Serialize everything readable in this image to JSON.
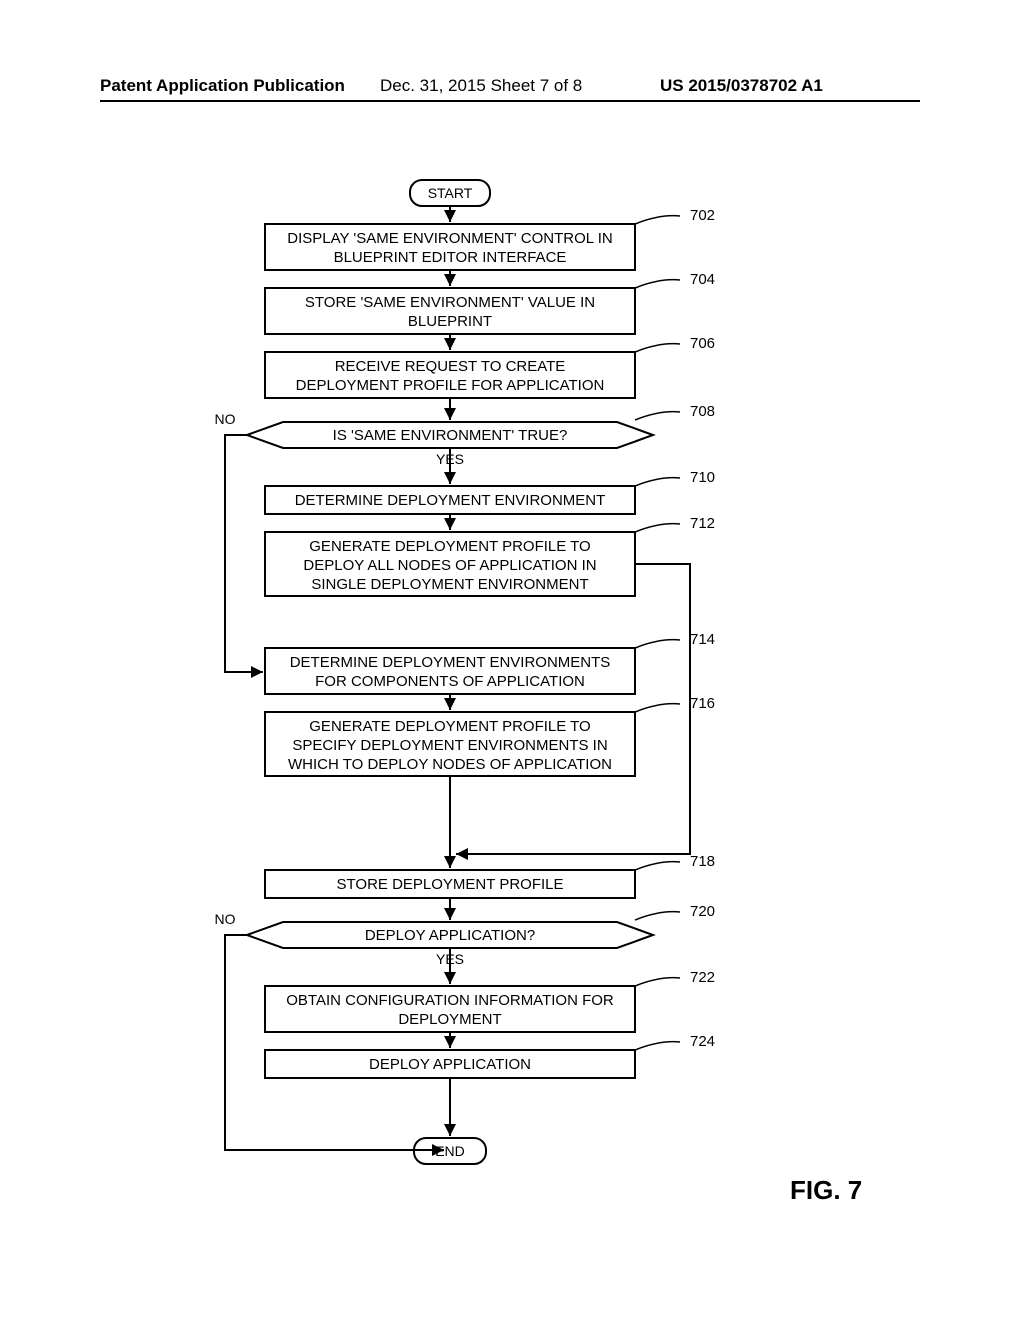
{
  "header": {
    "left": "Patent Application Publication",
    "center": "Dec. 31, 2015   Sheet 7 of 8",
    "right": "US 2015/0378702 A1"
  },
  "figure_caption": "FIG. 7",
  "terminals": {
    "start": "START",
    "end": "END"
  },
  "labels": {
    "no": "NO",
    "yes": "YES"
  },
  "steps": {
    "702": {
      "ref": "702",
      "lines": [
        "DISPLAY 'SAME ENVIRONMENT' CONTROL IN",
        "BLUEPRINT EDITOR INTERFACE"
      ]
    },
    "704": {
      "ref": "704",
      "lines": [
        "STORE 'SAME ENVIRONMENT' VALUE IN",
        "BLUEPRINT"
      ]
    },
    "706": {
      "ref": "706",
      "lines": [
        "RECEIVE REQUEST TO CREATE",
        "DEPLOYMENT PROFILE FOR APPLICATION"
      ]
    },
    "708": {
      "ref": "708",
      "lines": [
        "IS 'SAME ENVIRONMENT' TRUE?"
      ]
    },
    "710": {
      "ref": "710",
      "lines": [
        "DETERMINE DEPLOYMENT ENVIRONMENT"
      ]
    },
    "712": {
      "ref": "712",
      "lines": [
        "GENERATE DEPLOYMENT PROFILE TO",
        "DEPLOY ALL NODES OF APPLICATION IN",
        "SINGLE DEPLOYMENT ENVIRONMENT"
      ]
    },
    "714": {
      "ref": "714",
      "lines": [
        "DETERMINE DEPLOYMENT ENVIRONMENTS",
        "FOR COMPONENTS OF APPLICATION"
      ]
    },
    "716": {
      "ref": "716",
      "lines": [
        "GENERATE DEPLOYMENT PROFILE TO",
        "SPECIFY DEPLOYMENT ENVIRONMENTS IN",
        "WHICH TO DEPLOY NODES OF APPLICATION"
      ]
    },
    "718": {
      "ref": "718",
      "lines": [
        "STORE DEPLOYMENT PROFILE"
      ]
    },
    "720": {
      "ref": "720",
      "lines": [
        "DEPLOY APPLICATION?"
      ]
    },
    "722": {
      "ref": "722",
      "lines": [
        "OBTAIN CONFIGURATION INFORMATION FOR",
        "DEPLOYMENT"
      ]
    },
    "724": {
      "ref": "724",
      "lines": [
        "DEPLOY APPLICATION"
      ]
    }
  }
}
